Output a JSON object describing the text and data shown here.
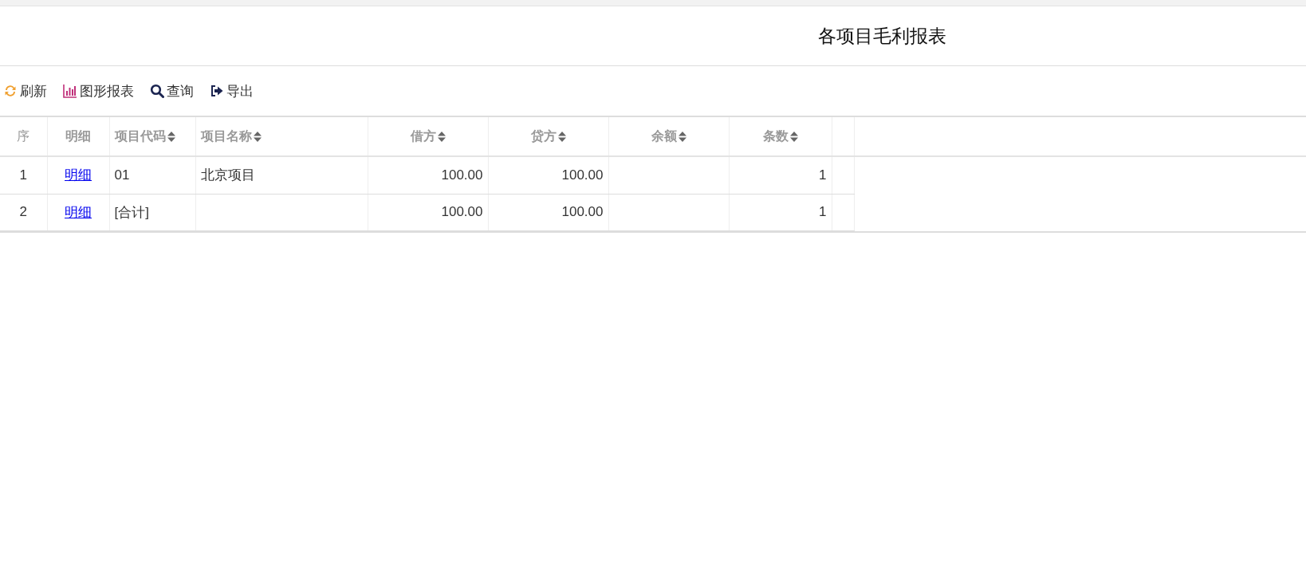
{
  "title": "各项目毛利报表",
  "toolbar": [
    {
      "label": "刷新",
      "kind": "refresh"
    },
    {
      "label": "图形报表",
      "kind": "chart"
    },
    {
      "label": "查询",
      "kind": "search"
    },
    {
      "label": "导出",
      "kind": "export"
    }
  ],
  "table": {
    "columns": [
      {
        "label": "序",
        "kind": "index",
        "sortable": false
      },
      {
        "label": "明细",
        "kind": "link",
        "sortable": false
      },
      {
        "label": "项目代码",
        "kind": "text",
        "sortable": true
      },
      {
        "label": "项目名称",
        "kind": "text",
        "sortable": true
      },
      {
        "label": "借方",
        "kind": "number",
        "sortable": true
      },
      {
        "label": "贷方",
        "kind": "number",
        "sortable": true
      },
      {
        "label": "余额",
        "kind": "number",
        "sortable": true
      },
      {
        "label": "条数",
        "kind": "number",
        "sortable": true
      }
    ],
    "rows": [
      [
        "1",
        "明细",
        "01",
        "北京项目",
        "100.00",
        "100.00",
        "",
        "1"
      ],
      [
        "2",
        "明细",
        "[合计]",
        "",
        "100.00",
        "100.00",
        "",
        "1"
      ]
    ]
  }
}
